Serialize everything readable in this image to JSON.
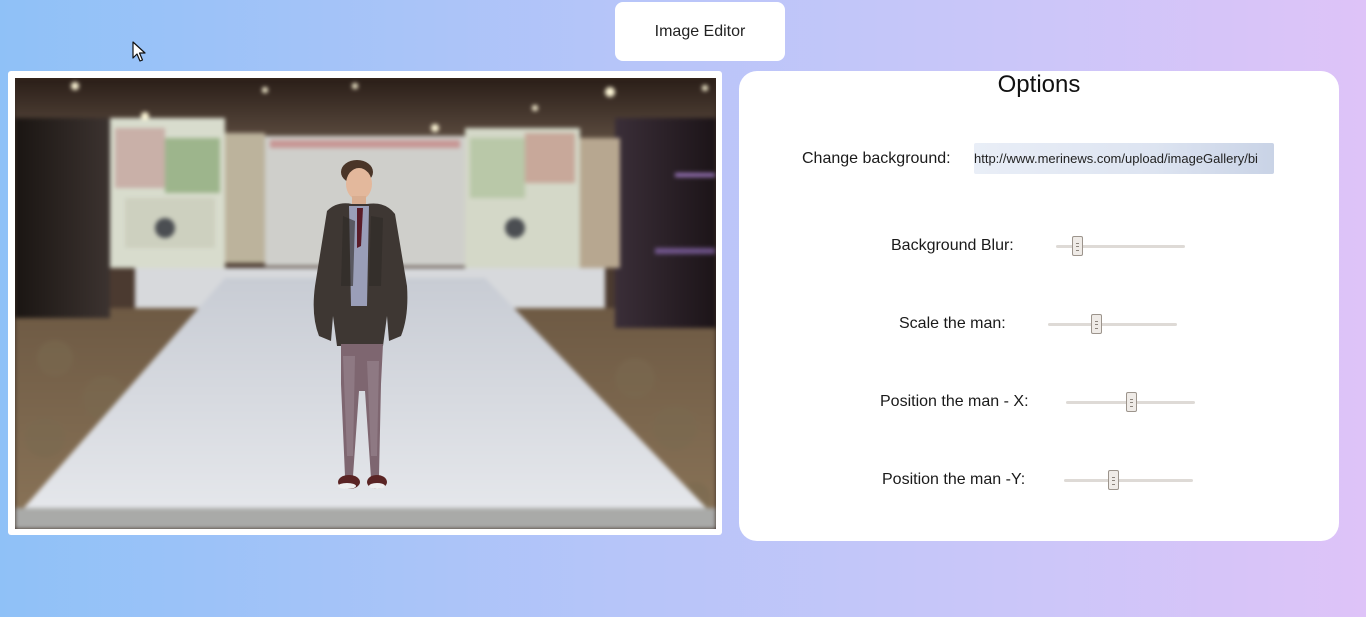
{
  "header": {
    "title": "Image Editor"
  },
  "options": {
    "title": "Options",
    "background": {
      "label": "Change background:",
      "value": "http://www.merinews.com/upload/imageGallery/bi"
    },
    "sliders": [
      {
        "label": "Background Blur:",
        "value_fraction": 0.16
      },
      {
        "label": "Scale the man:",
        "value_fraction": 0.37
      },
      {
        "label": "Position the man - X:",
        "value_fraction": 0.5
      },
      {
        "label": "Position the man -Y:",
        "value_fraction": 0.38
      }
    ]
  },
  "icons": {
    "cursor": "mouse-pointer-icon"
  }
}
